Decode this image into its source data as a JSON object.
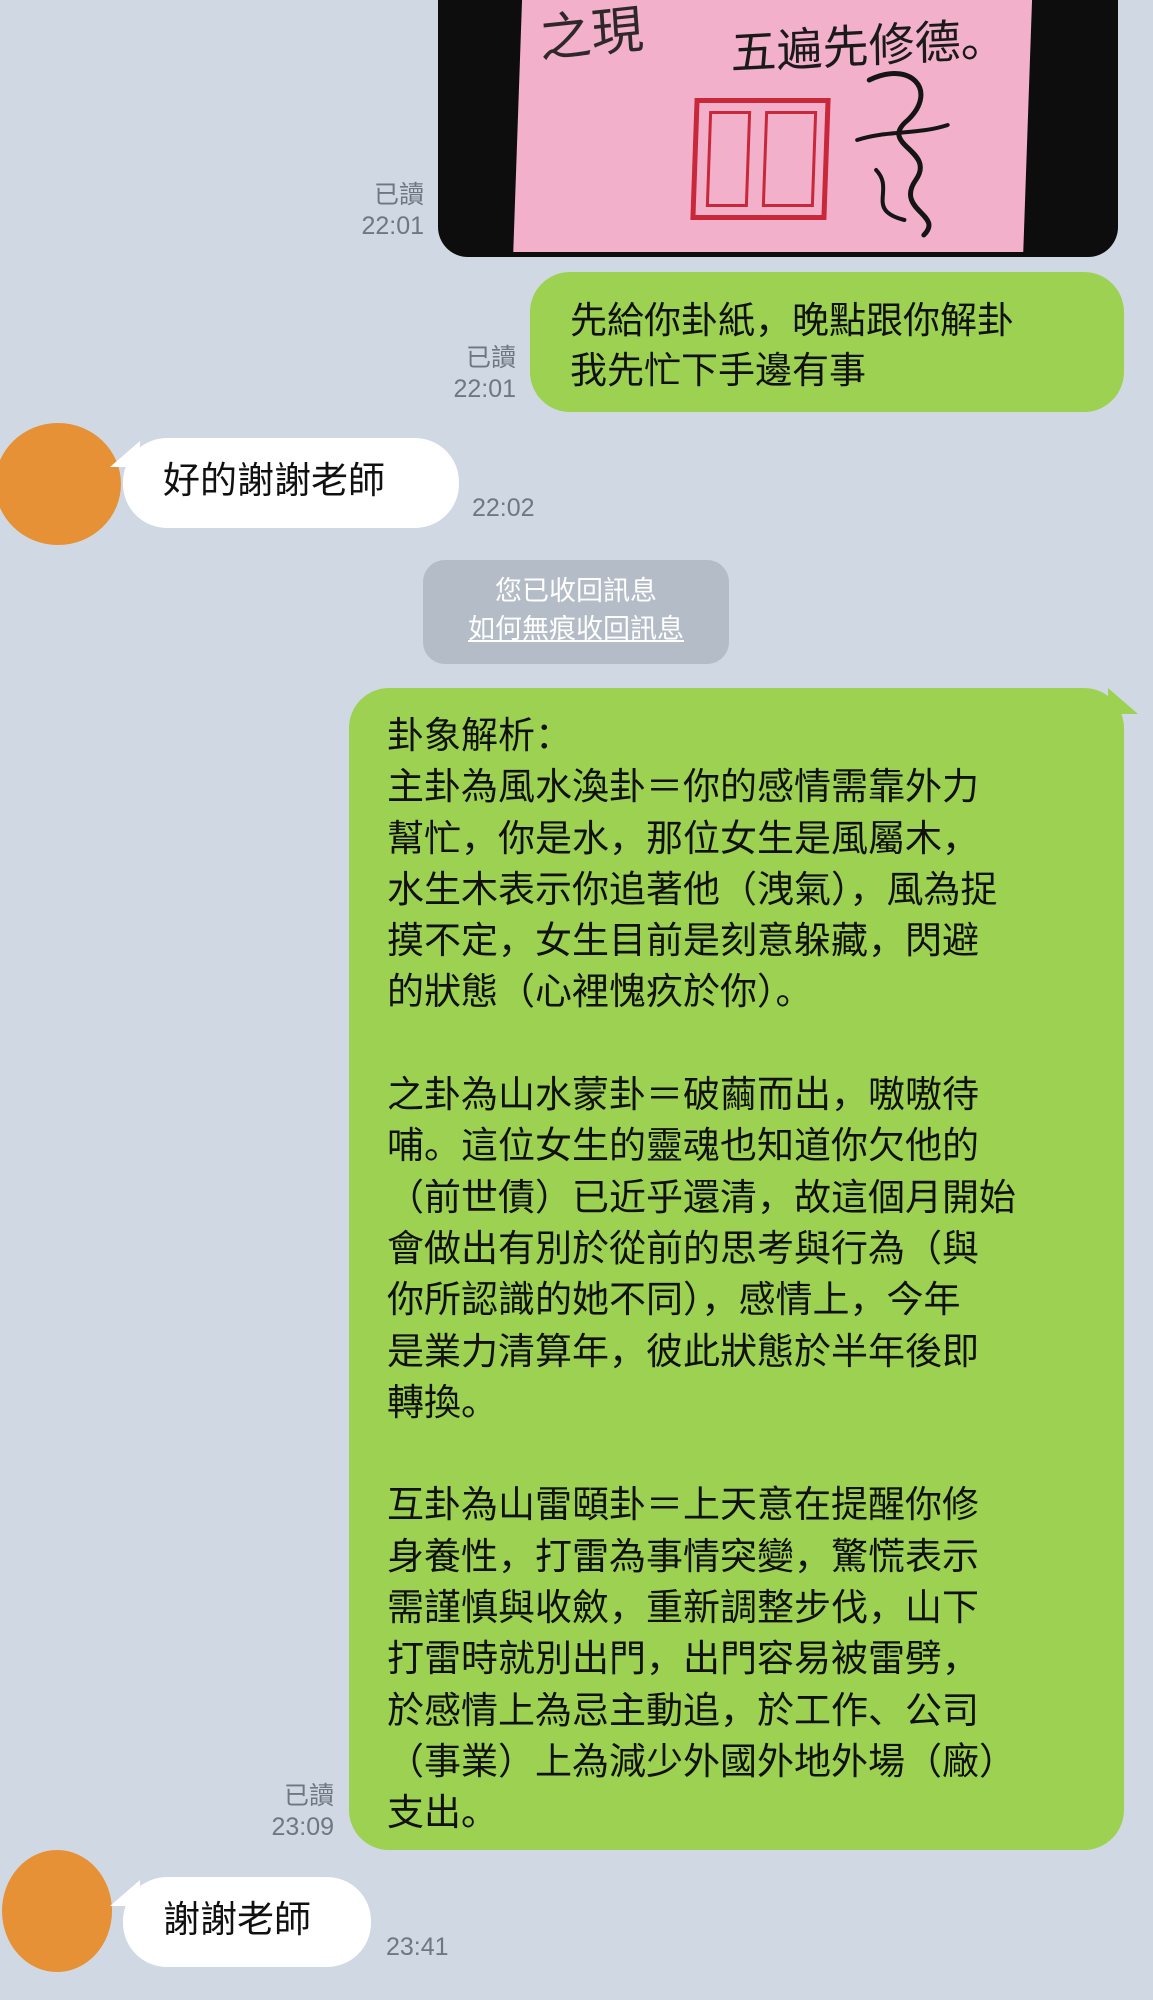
{
  "messages": [
    {
      "kind": "image",
      "direction": "outgoing",
      "image_text": {
        "line1": "五遍先修德。",
        "partial": "之現"
      },
      "read_label": "已讀",
      "time": "22:01"
    },
    {
      "kind": "text",
      "direction": "outgoing",
      "text": "先給你卦紙，晚點跟你解卦\n我先忙下手邊有事",
      "read_label": "已讀",
      "time": "22:01"
    },
    {
      "kind": "text",
      "direction": "incoming",
      "text": "好的謝謝老師",
      "time": "22:02"
    },
    {
      "kind": "system",
      "text": "您已收回訊息",
      "link": "如何無痕收回訊息"
    },
    {
      "kind": "text",
      "direction": "outgoing",
      "text": "卦象解析：\n主卦為風水渙卦＝你的感情需靠外力\n幫忙，你是水，那位女生是風屬木，\n水生木表示你追著他（洩氣），風為捉\n摸不定，女生目前是刻意躲藏，閃避\n的狀態（心裡愧疚於你）。\n\n之卦為山水蒙卦＝破繭而出，嗷嗷待\n哺。這位女生的靈魂也知道你欠他的\n（前世債）已近乎還清，故這個月開始\n會做出有別於從前的思考與行為（與\n你所認識的她不同），感情上，今年\n是業力清算年，彼此狀態於半年後即\n轉換。\n\n互卦為山雷頤卦＝上天意在提醒你修\n身養性，打雷為事情突變，驚慌表示\n需謹慎與收斂，重新調整步伐，山下\n打雷時就別出門，出門容易被雷劈，\n於感情上為忌主動追，於工作、公司\n（事業）上為減少外國外地外場（廠）\n支出。",
      "read_label": "已讀",
      "time": "23:09"
    },
    {
      "kind": "text",
      "direction": "incoming",
      "text": "謝謝老師",
      "time": "23:41"
    }
  ],
  "colors": {
    "background": "#cfd8e3",
    "outgoing_bubble": "#9cd151",
    "incoming_bubble": "#ffffff",
    "avatar": "#e69135",
    "system_bubble": "#b4bcc7",
    "meta_text": "#6f7782",
    "seal_red": "#c8283a",
    "paper_pink": "#f2b0cb"
  }
}
